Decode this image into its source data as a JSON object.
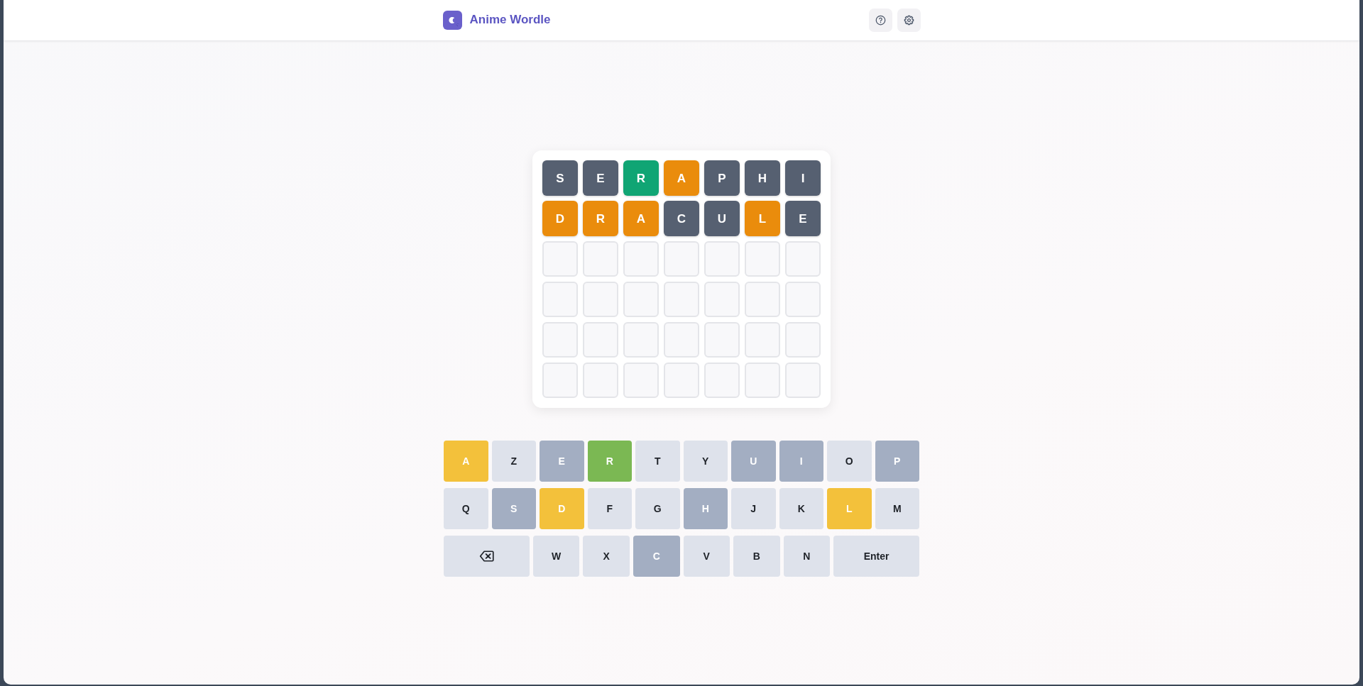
{
  "header": {
    "title": "Anime Wordle",
    "buttons": [
      {
        "kind": "help"
      },
      {
        "kind": "settings"
      }
    ]
  },
  "board": {
    "rows": [
      {
        "tiles": [
          {
            "filled": true,
            "letter": "S",
            "color": "#566071"
          },
          {
            "filled": true,
            "letter": "E",
            "color": "#566071"
          },
          {
            "filled": true,
            "letter": "R",
            "color": "#10a574"
          },
          {
            "filled": true,
            "letter": "A",
            "color": "#ea8c0c"
          },
          {
            "filled": true,
            "letter": "P",
            "color": "#566071"
          },
          {
            "filled": true,
            "letter": "H",
            "color": "#566071"
          },
          {
            "filled": true,
            "letter": "I",
            "color": "#566071"
          }
        ]
      },
      {
        "tiles": [
          {
            "filled": true,
            "letter": "D",
            "color": "#ea8c0c"
          },
          {
            "filled": true,
            "letter": "R",
            "color": "#ea8c0c"
          },
          {
            "filled": true,
            "letter": "A",
            "color": "#ea8c0c"
          },
          {
            "filled": true,
            "letter": "C",
            "color": "#566071"
          },
          {
            "filled": true,
            "letter": "U",
            "color": "#566071"
          },
          {
            "filled": true,
            "letter": "L",
            "color": "#ea8c0c"
          },
          {
            "filled": true,
            "letter": "E",
            "color": "#566071"
          }
        ]
      },
      {
        "tiles": [
          {
            "filled": false
          },
          {
            "filled": false
          },
          {
            "filled": false
          },
          {
            "filled": false
          },
          {
            "filled": false
          },
          {
            "filled": false
          },
          {
            "filled": false
          }
        ]
      },
      {
        "tiles": [
          {
            "filled": false
          },
          {
            "filled": false
          },
          {
            "filled": false
          },
          {
            "filled": false
          },
          {
            "filled": false
          },
          {
            "filled": false
          },
          {
            "filled": false
          }
        ]
      },
      {
        "tiles": [
          {
            "filled": false
          },
          {
            "filled": false
          },
          {
            "filled": false
          },
          {
            "filled": false
          },
          {
            "filled": false
          },
          {
            "filled": false
          },
          {
            "filled": false
          }
        ]
      },
      {
        "tiles": [
          {
            "filled": false
          },
          {
            "filled": false
          },
          {
            "filled": false
          },
          {
            "filled": false
          },
          {
            "filled": false
          },
          {
            "filled": false
          },
          {
            "filled": false
          }
        ]
      }
    ]
  },
  "keyboard": {
    "rows": [
      {
        "keys": [
          {
            "kind": "letter",
            "label": "A",
            "guessed": true,
            "color": "#f3c13b"
          },
          {
            "kind": "letter",
            "label": "Z",
            "guessed": false,
            "color": "#dee2eb"
          },
          {
            "kind": "letter",
            "label": "E",
            "guessed": true,
            "color": "#a3aec2"
          },
          {
            "kind": "letter",
            "label": "R",
            "guessed": true,
            "color": "#7bb853"
          },
          {
            "kind": "letter",
            "label": "T",
            "guessed": false,
            "color": "#dee2eb"
          },
          {
            "kind": "letter",
            "label": "Y",
            "guessed": false,
            "color": "#dee2eb"
          },
          {
            "kind": "letter",
            "label": "U",
            "guessed": true,
            "color": "#a3aec2"
          },
          {
            "kind": "letter",
            "label": "I",
            "guessed": true,
            "color": "#a3aec2"
          },
          {
            "kind": "letter",
            "label": "O",
            "guessed": false,
            "color": "#dee2eb"
          },
          {
            "kind": "letter",
            "label": "P",
            "guessed": true,
            "color": "#a3aec2"
          }
        ]
      },
      {
        "keys": [
          {
            "kind": "letter",
            "label": "Q",
            "guessed": false,
            "color": "#dee2eb"
          },
          {
            "kind": "letter",
            "label": "S",
            "guessed": true,
            "color": "#a3aec2"
          },
          {
            "kind": "letter",
            "label": "D",
            "guessed": true,
            "color": "#f3c13b"
          },
          {
            "kind": "letter",
            "label": "F",
            "guessed": false,
            "color": "#dee2eb"
          },
          {
            "kind": "letter",
            "label": "G",
            "guessed": false,
            "color": "#dee2eb"
          },
          {
            "kind": "letter",
            "label": "H",
            "guessed": true,
            "color": "#a3aec2"
          },
          {
            "kind": "letter",
            "label": "J",
            "guessed": false,
            "color": "#dee2eb"
          },
          {
            "kind": "letter",
            "label": "K",
            "guessed": false,
            "color": "#dee2eb"
          },
          {
            "kind": "letter",
            "label": "L",
            "guessed": true,
            "color": "#f3c13b"
          },
          {
            "kind": "letter",
            "label": "M",
            "guessed": false,
            "color": "#dee2eb"
          }
        ]
      },
      {
        "keys": [
          {
            "kind": "backspace",
            "color": "#dee2eb"
          },
          {
            "kind": "letter",
            "label": "W",
            "guessed": false,
            "color": "#dee2eb"
          },
          {
            "kind": "letter",
            "label": "X",
            "guessed": false,
            "color": "#dee2eb"
          },
          {
            "kind": "letter",
            "label": "C",
            "guessed": true,
            "color": "#a3aec2"
          },
          {
            "kind": "letter",
            "label": "V",
            "guessed": false,
            "color": "#dee2eb"
          },
          {
            "kind": "letter",
            "label": "B",
            "guessed": false,
            "color": "#dee2eb"
          },
          {
            "kind": "letter",
            "label": "N",
            "guessed": false,
            "color": "#dee2eb"
          },
          {
            "kind": "enter",
            "label": "Enter",
            "color": "#dee2eb"
          }
        ]
      }
    ]
  }
}
